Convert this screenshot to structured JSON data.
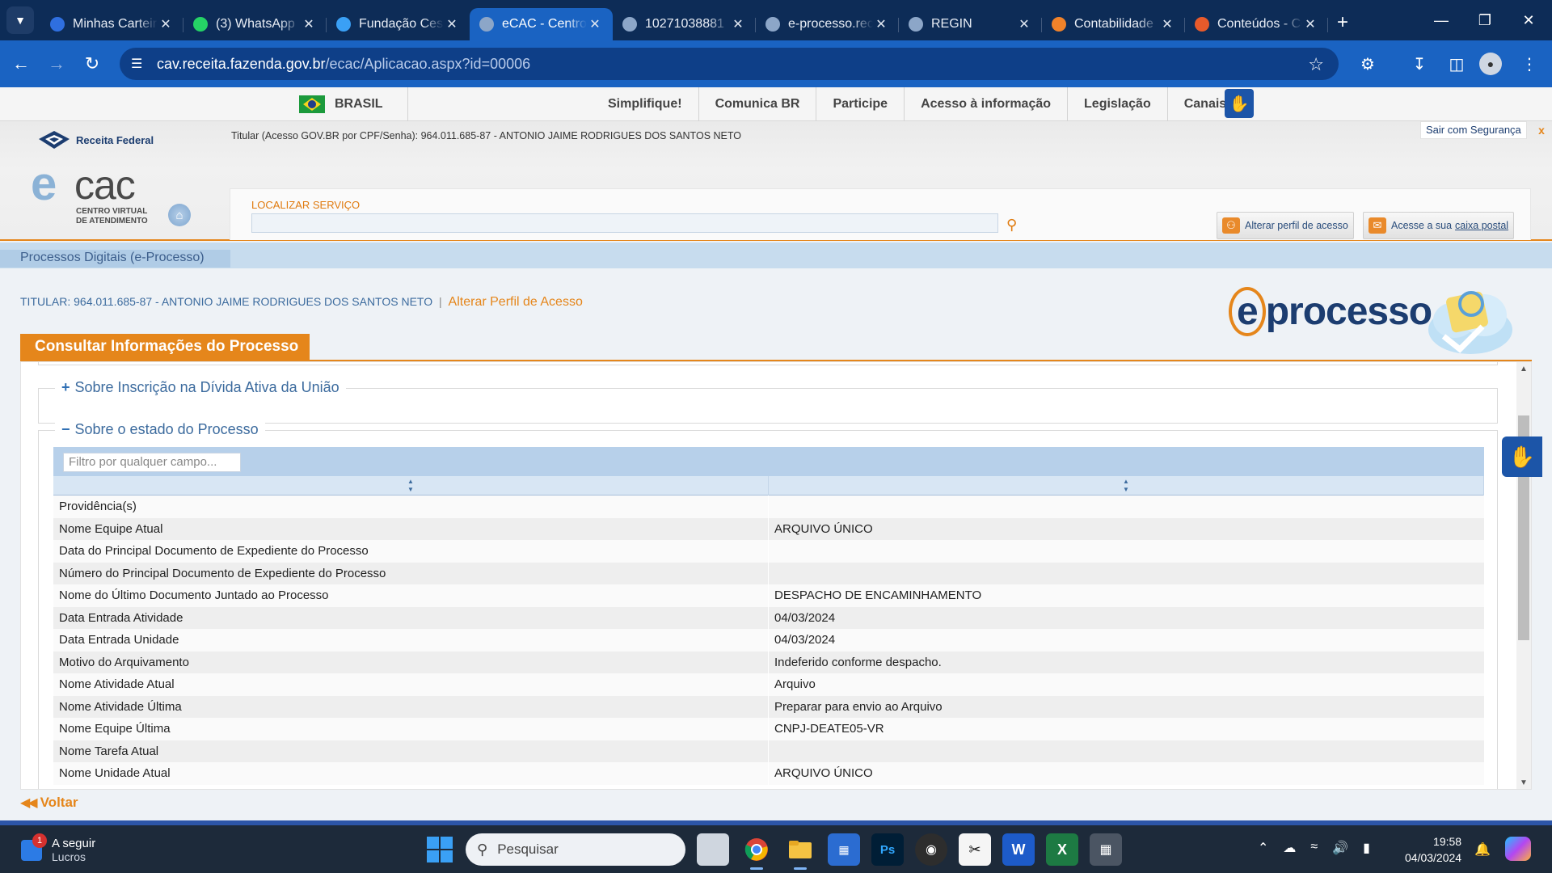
{
  "browser": {
    "tabs": [
      {
        "title": "Minhas Carteiras",
        "favicon": "chart-icon",
        "color": "#2f6fe0",
        "active": false
      },
      {
        "title": "(3) WhatsApp",
        "favicon": "whatsapp-icon",
        "color": "#25d366",
        "active": false
      },
      {
        "title": "Fundação Cesgranrio",
        "favicon": "arrow-icon",
        "color": "#3aa0f5",
        "active": false
      },
      {
        "title": "eCAC - Centro Virtual",
        "favicon": "globe-icon",
        "color": "#8ca6c8",
        "active": true
      },
      {
        "title": "10271038881",
        "favicon": "globe-icon",
        "color": "#8ca6c8",
        "active": false
      },
      {
        "title": "e-processo.receita",
        "favicon": "globe-icon",
        "color": "#8ca6c8",
        "active": false
      },
      {
        "title": "REGIN",
        "favicon": "globe-icon",
        "color": "#8ca6c8",
        "active": false
      },
      {
        "title": "Contabilidade",
        "favicon": "g-icon",
        "color": "#f0822a",
        "active": false
      },
      {
        "title": "Conteúdos - Contábeis",
        "favicon": "g-icon",
        "color": "#e85a2b",
        "active": false
      }
    ],
    "url_host": "cav.receita.fazenda.gov.br",
    "url_path": "/ecac/Aplicacao.aspx?id=00006"
  },
  "govbar": {
    "country": "BRASIL",
    "links": [
      "Simplifique!",
      "Comunica BR",
      "Participe",
      "Acesso à informação",
      "Legislação",
      "Canais"
    ]
  },
  "ecac": {
    "rf_logo": "Receita Federal",
    "logo_e": "e",
    "logo_cac": "cac",
    "logo_sub1": "CENTRO VIRTUAL",
    "logo_sub2": "DE ATENDIMENTO",
    "titular_top": "Titular (Acesso GOV.BR por CPF/Senha): 964.011.685-87 - ANTONIO JAIME RODRIGUES DOS SANTOS NETO",
    "logout": "Sair com Segurança",
    "logout_x": "x",
    "search_label": "LOCALIZAR SERVIÇO",
    "btn_perfil": "Alterar perfil de acesso",
    "btn_caixa_prefix": "Acesse a sua",
    "btn_caixa_link": "caixa postal"
  },
  "content": {
    "breadcrumb": "Processos Digitais (e-Processo)",
    "titular": "TITULAR: 964.011.685-87 - ANTONIO JAIME RODRIGUES DOS SANTOS NETO",
    "pipe": "|",
    "alterar_perfil": "Alterar Perfil de Acesso",
    "eproc_logo": "processo",
    "eproc_logo_e": "e",
    "section_title": "Consultar Informações do Processo",
    "fieldset1": {
      "symbol": "+",
      "label": "Sobre Inscrição na Dívida Ativa da União"
    },
    "fieldset2": {
      "symbol": "−",
      "label": "Sobre o estado do Processo"
    },
    "filter_placeholder": "Filtro por qualquer campo...",
    "rows": [
      {
        "label": "Providência(s)",
        "value": ""
      },
      {
        "label": "Nome Equipe Atual",
        "value": "ARQUIVO ÚNICO"
      },
      {
        "label": "Data do Principal Documento de Expediente do Processo",
        "value": ""
      },
      {
        "label": "Número do Principal Documento de Expediente do Processo",
        "value": ""
      },
      {
        "label": "Nome do Último Documento Juntado ao Processo",
        "value": "DESPACHO DE ENCAMINHAMENTO"
      },
      {
        "label": "Data Entrada Atividade",
        "value": "04/03/2024"
      },
      {
        "label": "Data Entrada Unidade",
        "value": "04/03/2024"
      },
      {
        "label": "Motivo do Arquivamento",
        "value": "Indeferido conforme despacho."
      },
      {
        "label": "Nome Atividade Atual",
        "value": "Arquivo"
      },
      {
        "label": "Nome Atividade Última",
        "value": "Preparar para envio ao Arquivo"
      },
      {
        "label": "Nome Equipe Última",
        "value": "CNPJ-DEATE05-VR"
      },
      {
        "label": "Nome Tarefa Atual",
        "value": ""
      },
      {
        "label": "Nome Unidade Atual",
        "value": "ARQUIVO ÚNICO"
      }
    ],
    "voltar": "Voltar"
  },
  "taskbar": {
    "weather_title": "A seguir",
    "weather_sub": "Lucros",
    "weather_badge": "1",
    "search": "Pesquisar",
    "time": "19:58",
    "date": "04/03/2024"
  }
}
